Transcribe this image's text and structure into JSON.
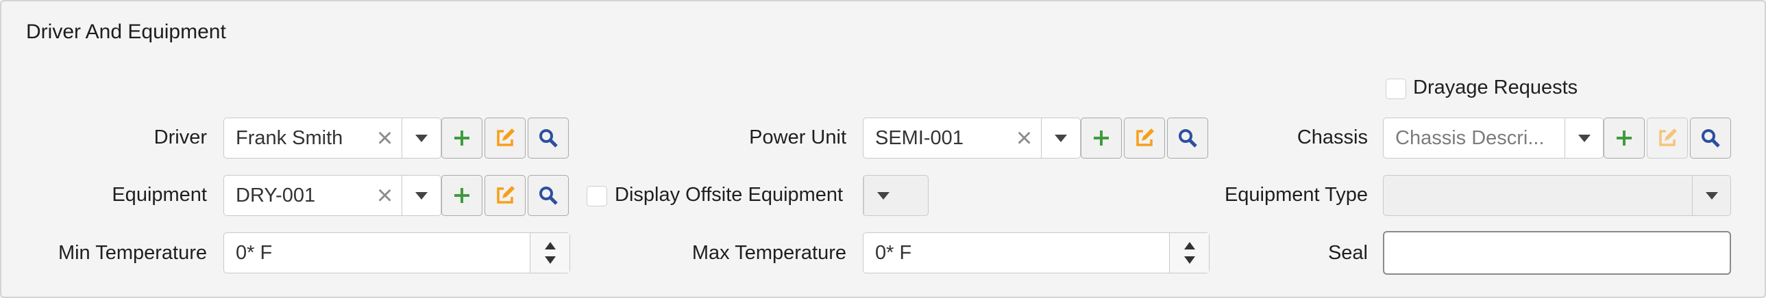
{
  "section": {
    "title": "Driver And Equipment"
  },
  "driver": {
    "label": "Driver",
    "value": "Frank Smith"
  },
  "equipment": {
    "label": "Equipment",
    "value": "DRY-001"
  },
  "min_temperature": {
    "label": "Min Temperature",
    "value": "0* F"
  },
  "power_unit": {
    "label": "Power Unit",
    "value": "SEMI-001"
  },
  "display_offsite": {
    "label": "Display Offsite Equipment",
    "checked": false
  },
  "max_temperature": {
    "label": "Max Temperature",
    "value": "0* F"
  },
  "drayage": {
    "label": "Drayage Requests",
    "checked": false
  },
  "chassis": {
    "label": "Chassis",
    "placeholder": "Chassis Descri..."
  },
  "equipment_type": {
    "label": "Equipment Type",
    "value": ""
  },
  "seal": {
    "label": "Seal",
    "value": ""
  },
  "icons": {
    "add": "plus-icon",
    "edit": "edit-icon",
    "search": "search-icon",
    "clear": "clear-icon",
    "dropdown": "chevron-down-icon"
  },
  "colors": {
    "add": "#3f9b3f",
    "edit": "#f5a01a",
    "search": "#2d4f9e"
  }
}
